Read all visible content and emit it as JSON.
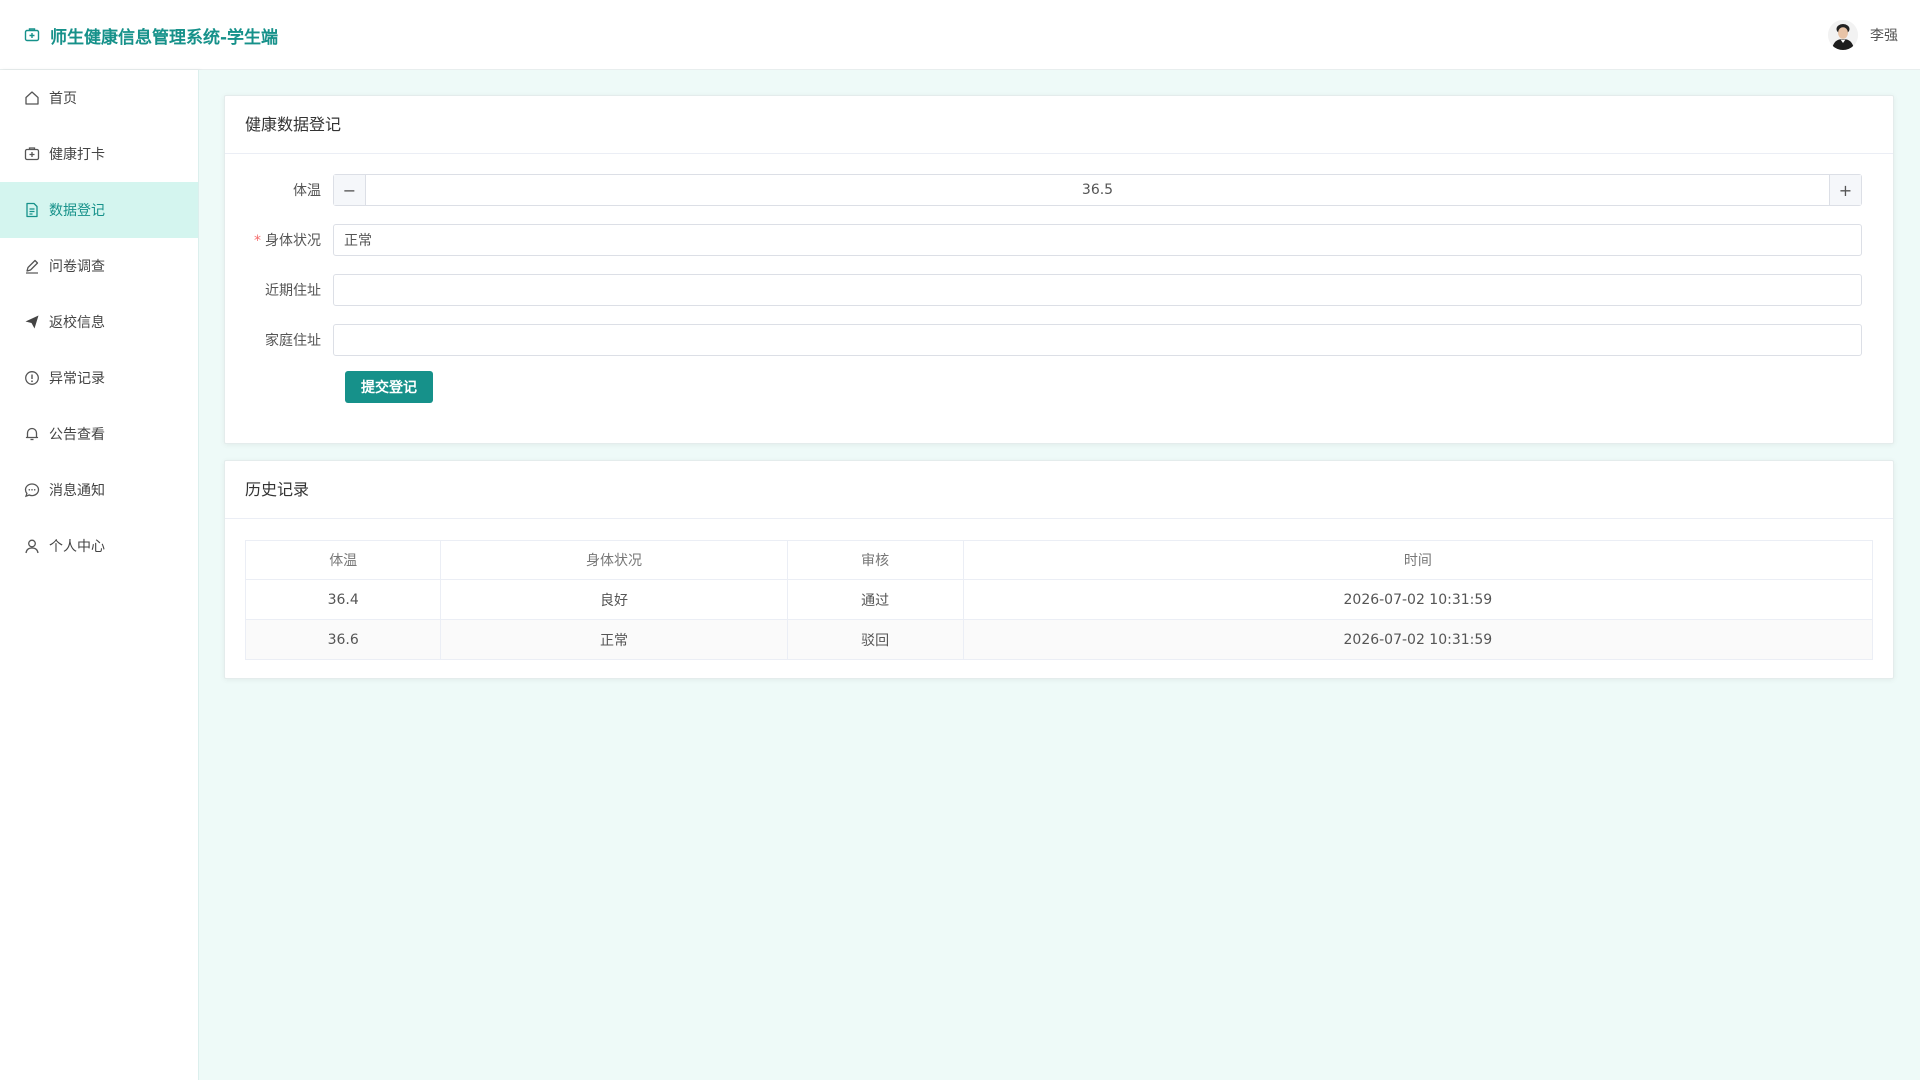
{
  "header": {
    "title": "师生健康信息管理系统-学生端",
    "username": "李强"
  },
  "sidebar": {
    "items": [
      {
        "label": "首页",
        "icon": "home-icon"
      },
      {
        "label": "健康打卡",
        "icon": "medical-kit-icon"
      },
      {
        "label": "数据登记",
        "icon": "document-icon",
        "active": true
      },
      {
        "label": "问卷调查",
        "icon": "pen-icon"
      },
      {
        "label": "返校信息",
        "icon": "paper-plane-icon"
      },
      {
        "label": "异常记录",
        "icon": "warning-circle-icon"
      },
      {
        "label": "公告查看",
        "icon": "bell-icon"
      },
      {
        "label": "消息通知",
        "icon": "chat-icon"
      },
      {
        "label": "个人中心",
        "icon": "user-icon"
      }
    ]
  },
  "form": {
    "title": "健康数据登记",
    "temperature_label": "体温",
    "temperature_value": "36.5",
    "minus": "−",
    "plus": "+",
    "required_mark": "*",
    "condition_label": "身体状况",
    "condition_value": "正常",
    "recent_address_label": "近期住址",
    "recent_address_value": "",
    "home_address_label": "家庭住址",
    "home_address_value": "",
    "submit_label": "提交登记"
  },
  "history": {
    "title": "历史记录",
    "columns": [
      "体温",
      "身体状况",
      "审核",
      "时间"
    ],
    "rows": [
      [
        "36.4",
        "良好",
        "通过",
        "2026-07-02 10:31:59"
      ],
      [
        "36.6",
        "正常",
        "驳回",
        "2026-07-02 10:31:59"
      ]
    ]
  },
  "colors": {
    "accent": "#16918a",
    "active_bg": "#d4f5ef",
    "content_bg": "#eefaf8"
  }
}
